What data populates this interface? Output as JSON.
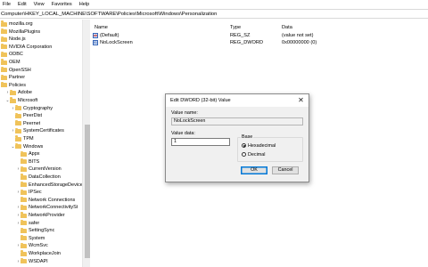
{
  "menu": [
    "File",
    "Edit",
    "View",
    "Favorites",
    "Help"
  ],
  "address": "Computer\\HKEY_LOCAL_MACHINE\\SOFTWARE\\Policies\\Microsoft\\Windows\\Personalization",
  "tree": [
    {
      "label": "mozilla.org",
      "toggle": "",
      "level": 0
    },
    {
      "label": "MozillaPlugins",
      "toggle": "",
      "level": 0
    },
    {
      "label": "Node.js",
      "toggle": "",
      "level": 0
    },
    {
      "label": "NVIDIA Corporation",
      "toggle": "",
      "level": 0
    },
    {
      "label": "ODBC",
      "toggle": "",
      "level": 0
    },
    {
      "label": "OEM",
      "toggle": "",
      "level": 0
    },
    {
      "label": "OpenSSH",
      "toggle": "",
      "level": 0
    },
    {
      "label": "Partner",
      "toggle": "",
      "level": 0
    },
    {
      "label": "Policies",
      "toggle": "",
      "level": 0
    },
    {
      "label": "Adobe",
      "toggle": ">",
      "level": 1
    },
    {
      "label": "Microsoft",
      "toggle": "v",
      "level": 1
    },
    {
      "label": "Cryptography",
      "toggle": ">",
      "level": 2
    },
    {
      "label": "PeerDist",
      "toggle": "",
      "level": 2
    },
    {
      "label": "Peernet",
      "toggle": "",
      "level": 2
    },
    {
      "label": "SystemCertificates",
      "toggle": ">",
      "level": 2
    },
    {
      "label": "TPM",
      "toggle": "",
      "level": 2
    },
    {
      "label": "Windows",
      "toggle": "v",
      "level": 2
    },
    {
      "label": "Appx",
      "toggle": "",
      "level": 3
    },
    {
      "label": "BITS",
      "toggle": "",
      "level": 3
    },
    {
      "label": "CurrentVersion",
      "toggle": ">",
      "level": 3
    },
    {
      "label": "DataCollection",
      "toggle": "",
      "level": 3
    },
    {
      "label": "EnhancedStorageDevice",
      "toggle": "",
      "level": 3
    },
    {
      "label": "IPSec",
      "toggle": ">",
      "level": 3
    },
    {
      "label": "Network Connections",
      "toggle": "",
      "level": 3
    },
    {
      "label": "NetworkConnectivitySt",
      "toggle": ">",
      "level": 3
    },
    {
      "label": "NetworkProvider",
      "toggle": ">",
      "level": 3
    },
    {
      "label": "safer",
      "toggle": ">",
      "level": 3
    },
    {
      "label": "SettingSync",
      "toggle": "",
      "level": 3
    },
    {
      "label": "System",
      "toggle": "",
      "level": 3
    },
    {
      "label": "WcmSvc",
      "toggle": ">",
      "level": 3
    },
    {
      "label": "WorkplaceJoin",
      "toggle": "",
      "level": 3
    },
    {
      "label": "WSDAPI",
      "toggle": ">",
      "level": 3
    }
  ],
  "columns": {
    "name": "Name",
    "type": "Type",
    "data": "Data"
  },
  "values": [
    {
      "icon": "ab",
      "name": "(Default)",
      "type": "REG_SZ",
      "data": "(value not set)"
    },
    {
      "icon": "bin",
      "name": "NoLockScreen",
      "type": "REG_DWORD",
      "data": "0x00000000 (0)"
    }
  ],
  "dialog": {
    "title": "Edit DWORD (32-bit) Value",
    "close": "✕",
    "value_name_label": "Value name:",
    "value_name": "NoLockScreen",
    "value_data_label": "Value data:",
    "value_data": "1",
    "base_label": "Base",
    "radios": [
      {
        "label": "Hexadecimal",
        "selected": true
      },
      {
        "label": "Decimal",
        "selected": false
      }
    ],
    "ok": "OK",
    "cancel": "Cancel"
  },
  "colors": {
    "folder": "#f0c35a",
    "accent": "#0078d7"
  }
}
